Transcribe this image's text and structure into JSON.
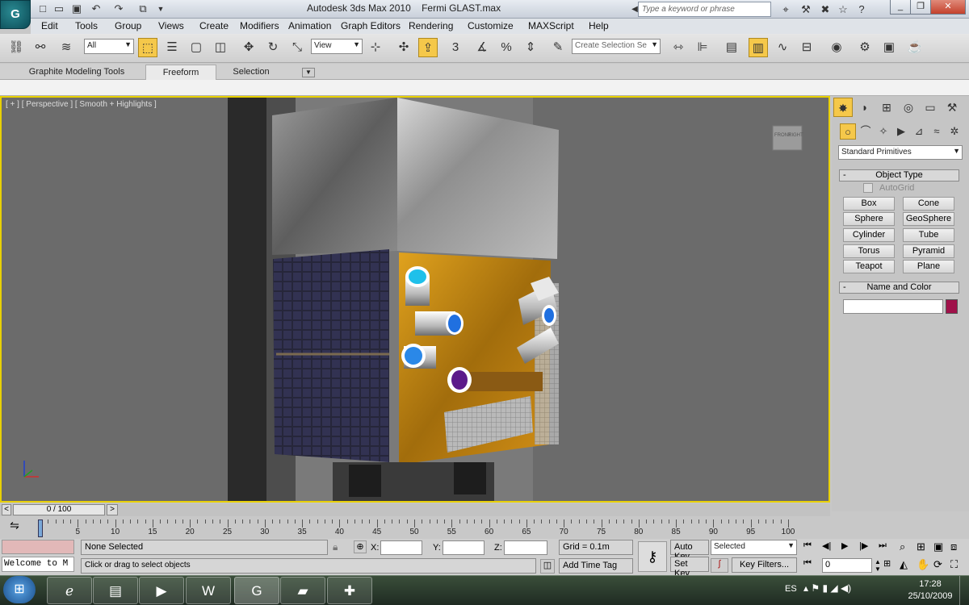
{
  "app": {
    "title": "Autodesk 3ds Max  2010",
    "filename": "Fermi GLAST.max",
    "logo_icon": "3dsmax-logo-icon"
  },
  "quick_access": [
    "new-file-icon",
    "open-file-icon",
    "save-icon",
    "undo-icon",
    "redo-icon",
    "project-folder-icon",
    "dropdown-icon"
  ],
  "search": {
    "placeholder": "Type a keyword or phrase"
  },
  "title_tools": [
    "binoculars-icon",
    "communication-center-icon",
    "favorites-icon",
    "help-icon"
  ],
  "window_buttons": {
    "minimize": "_",
    "restore": "❐",
    "close": "✕"
  },
  "menu": [
    "Edit",
    "Tools",
    "Group",
    "Views",
    "Create",
    "Modifiers",
    "Animation",
    "Graph Editors",
    "Rendering",
    "Customize",
    "MAXScript",
    "Help"
  ],
  "toolbar": {
    "selection_filter": "All",
    "ref_coord": "View",
    "named_selection_placeholder": "Create Selection Se",
    "snap_value": "3"
  },
  "ribbon": {
    "tabs": [
      "Graphite Modeling Tools",
      "Freeform",
      "Selection"
    ],
    "active": "Freeform"
  },
  "viewport": {
    "label": "[ + ] [ Perspective ] [ Smooth + Highlights ]",
    "viewcube_labels": [
      "FRONT",
      "RIGHT"
    ]
  },
  "command_panel": {
    "category": "Standard Primitives",
    "object_type_header": "Object Type",
    "autogrid": "AutoGrid",
    "buttons": [
      "Box",
      "Cone",
      "Sphere",
      "GeoSphere",
      "Cylinder",
      "Tube",
      "Torus",
      "Pyramid",
      "Teapot",
      "Plane"
    ],
    "name_color_header": "Name and Color",
    "object_color": "#a0114a"
  },
  "time": {
    "position": "0 / 100",
    "ticks": [
      0,
      5,
      10,
      15,
      20,
      25,
      30,
      35,
      40,
      45,
      50,
      55,
      60,
      65,
      70,
      75,
      80,
      85,
      90,
      95,
      100
    ]
  },
  "status": {
    "maxscript_listener": "Welcome to M",
    "selection": "None Selected",
    "prompt": "Click or drag to select objects",
    "x_label": "X:",
    "y_label": "Y:",
    "z_label": "Z:",
    "grid": "Grid = 0.1m",
    "add_time_tag": "Add Time Tag",
    "auto_key": "Auto Key",
    "set_key": "Set Key",
    "key_mode": "Selected",
    "key_filters": "Key Filters...",
    "frame": "0"
  },
  "taskbar": {
    "apps": [
      "internet-explorer-icon",
      "explorer-icon",
      "media-player-icon",
      "word-icon",
      "3dsmax-taskbar-icon",
      "folder-app-icon",
      "app-icon"
    ],
    "language": "ES",
    "time": "17:28",
    "date": "25/10/2009"
  }
}
